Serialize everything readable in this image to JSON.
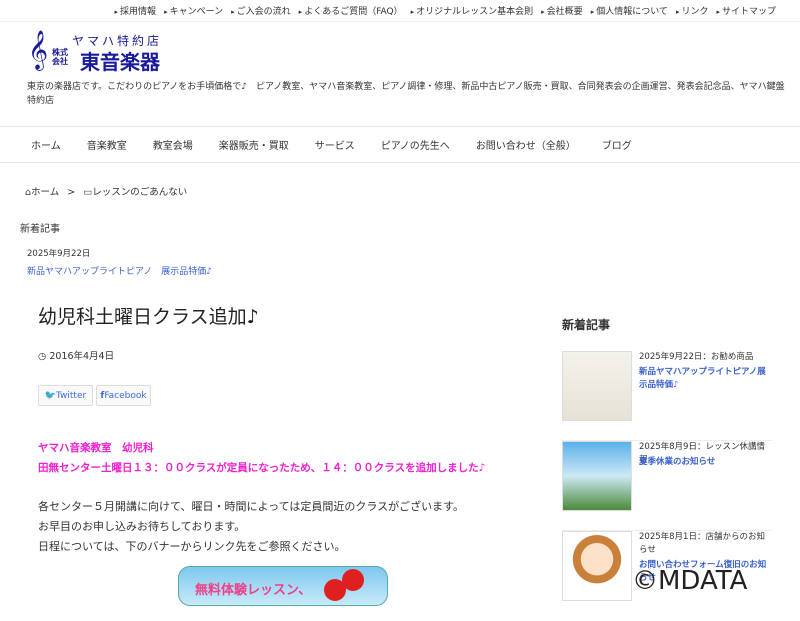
{
  "top_links": [
    "採用情報",
    "キャンペーン",
    "ご入会の流れ",
    "よくあるご質問（FAQ）",
    "オリジナルレッスン基本会則",
    "会社概要",
    "個人情報について",
    "リンク",
    "サイトマップ"
  ],
  "logo": {
    "tagline": "ヤマハ特約店",
    "kind": "株式\n会社",
    "name": "東音楽器"
  },
  "description": "東京の楽器店です。こだわりのピアノをお手頃価格で♪　ピアノ教室、ヤマハ音楽教室、ピアノ調律・修理、新品中古ピアノ販売・買取、合同発表会の企画運営、発表会記念品、ヤマハ鍵盤特約店",
  "nav": [
    "ホーム",
    "音楽教室",
    "教室会場",
    "楽器販売・買取",
    "サービス",
    "ピアノの先生へ",
    "お問い合わせ（全般）",
    "ブログ"
  ],
  "breadcrumb": {
    "home": "ホーム",
    "sep": ">",
    "category": "レッスンのごあんない"
  },
  "news": {
    "heading": "新着記事",
    "date": "2025年9月22日",
    "title": "新品ヤマハアップライトピアノ　展示品特価♪"
  },
  "post": {
    "title": "幼児科土曜日クラス追加♪",
    "date": "2016年4月4日",
    "twitter": "Twitter",
    "facebook": "Facebook",
    "highlight": [
      "ヤマハ音楽教室　幼児科",
      "田無センター土曜日１３：００クラスが定員になったため、１４：００クラスを追加しました♪"
    ],
    "body": [
      "各センター５月開講に向けて、曜日・時間によっては定員間近のクラスがございます。",
      "お早目のお申し込みお待ちしております。",
      "日程については、下のバナーからリンク先をご参照ください。"
    ],
    "banner": "無料体験レッスン、"
  },
  "sidebar": {
    "heading": "新着記事",
    "items": [
      {
        "meta": "2025年9月22日：お勧め商品",
        "title": "新品ヤマハアップライトピアノ展示品特価♪"
      },
      {
        "meta": "2025年8月9日：レッスン休講情報",
        "title": "夏季休業のお知らせ"
      },
      {
        "meta": "2025年8月1日：店舗からのお知らせ",
        "title": "お問い合わせフォーム復旧のお知らせ"
      }
    ]
  },
  "watermark": "©MDATA"
}
